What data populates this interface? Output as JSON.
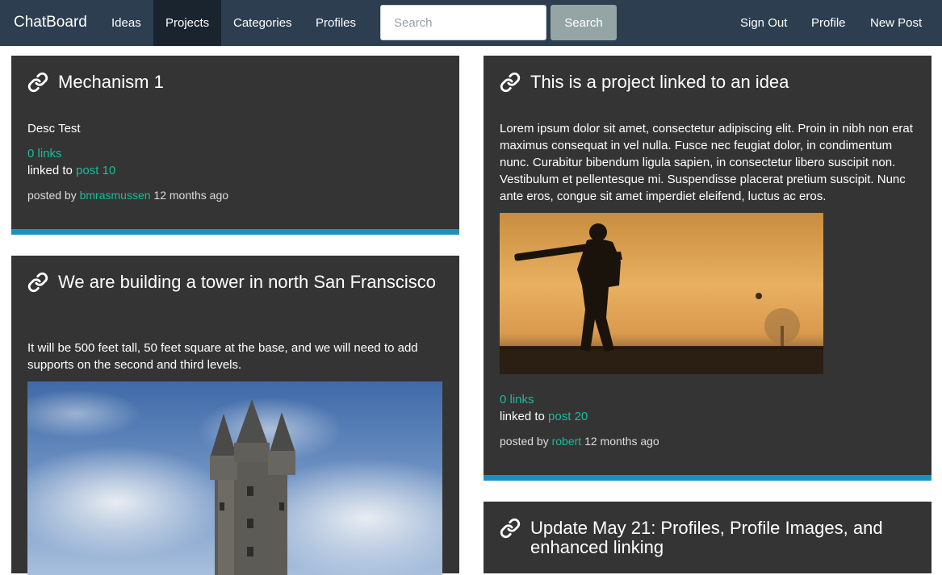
{
  "navbar": {
    "brand": "ChatBoard",
    "links": [
      {
        "label": "Ideas",
        "active": false
      },
      {
        "label": "Projects",
        "active": true
      },
      {
        "label": "Categories",
        "active": false
      },
      {
        "label": "Profiles",
        "active": false
      }
    ],
    "search": {
      "placeholder": "Search",
      "button_label": "Search"
    },
    "right_links": [
      {
        "label": "Sign Out"
      },
      {
        "label": "Profile"
      },
      {
        "label": "New Post"
      }
    ]
  },
  "colors": {
    "navbar_bg": "#2c3e50",
    "card_bg": "#343434",
    "accent_teal": "#18bc9c",
    "card_border_blue": "#1b8fc2"
  },
  "posts": [
    {
      "title": "Mechanism 1",
      "icon": "link-icon",
      "description": "Desc Test",
      "links_label": "0 links",
      "linked_to_prefix": "linked to",
      "linked_to": "post 10",
      "posted_by_prefix": "posted by",
      "author": "bmrasmussen",
      "time": "12 months ago"
    },
    {
      "title": "We are building a tower in north San Franscisco",
      "icon": "link-icon",
      "description": "It will be 500 feet tall, 50 feet square at the base, and we will need to add supports on the second and third levels.",
      "image": "tower-photo"
    },
    {
      "title": "This is a project linked to an idea",
      "icon": "link-icon",
      "description": "Lorem ipsum dolor sit amet, consectetur adipiscing elit. Proin in nibh non erat maximus consequat in vel nulla. Fusce nec feugiat dolor, in condimentum nunc. Curabitur bibendum ligula sapien, in consectetur libero suscipit non. Vestibulum et pellentesque mi. Suspendisse placerat pretium suscipit. Nunc ante eros, congue sit amet imperdiet eleifend, luctus ac eros.",
      "image": "cricket-batsman-photo",
      "links_label": "0 links",
      "linked_to_prefix": "linked to",
      "linked_to": "post 20",
      "posted_by_prefix": "posted by",
      "author": "robert",
      "time": "12 months ago"
    },
    {
      "title": "Update May 21: Profiles, Profile Images, and enhanced linking",
      "icon": "link-icon"
    }
  ]
}
